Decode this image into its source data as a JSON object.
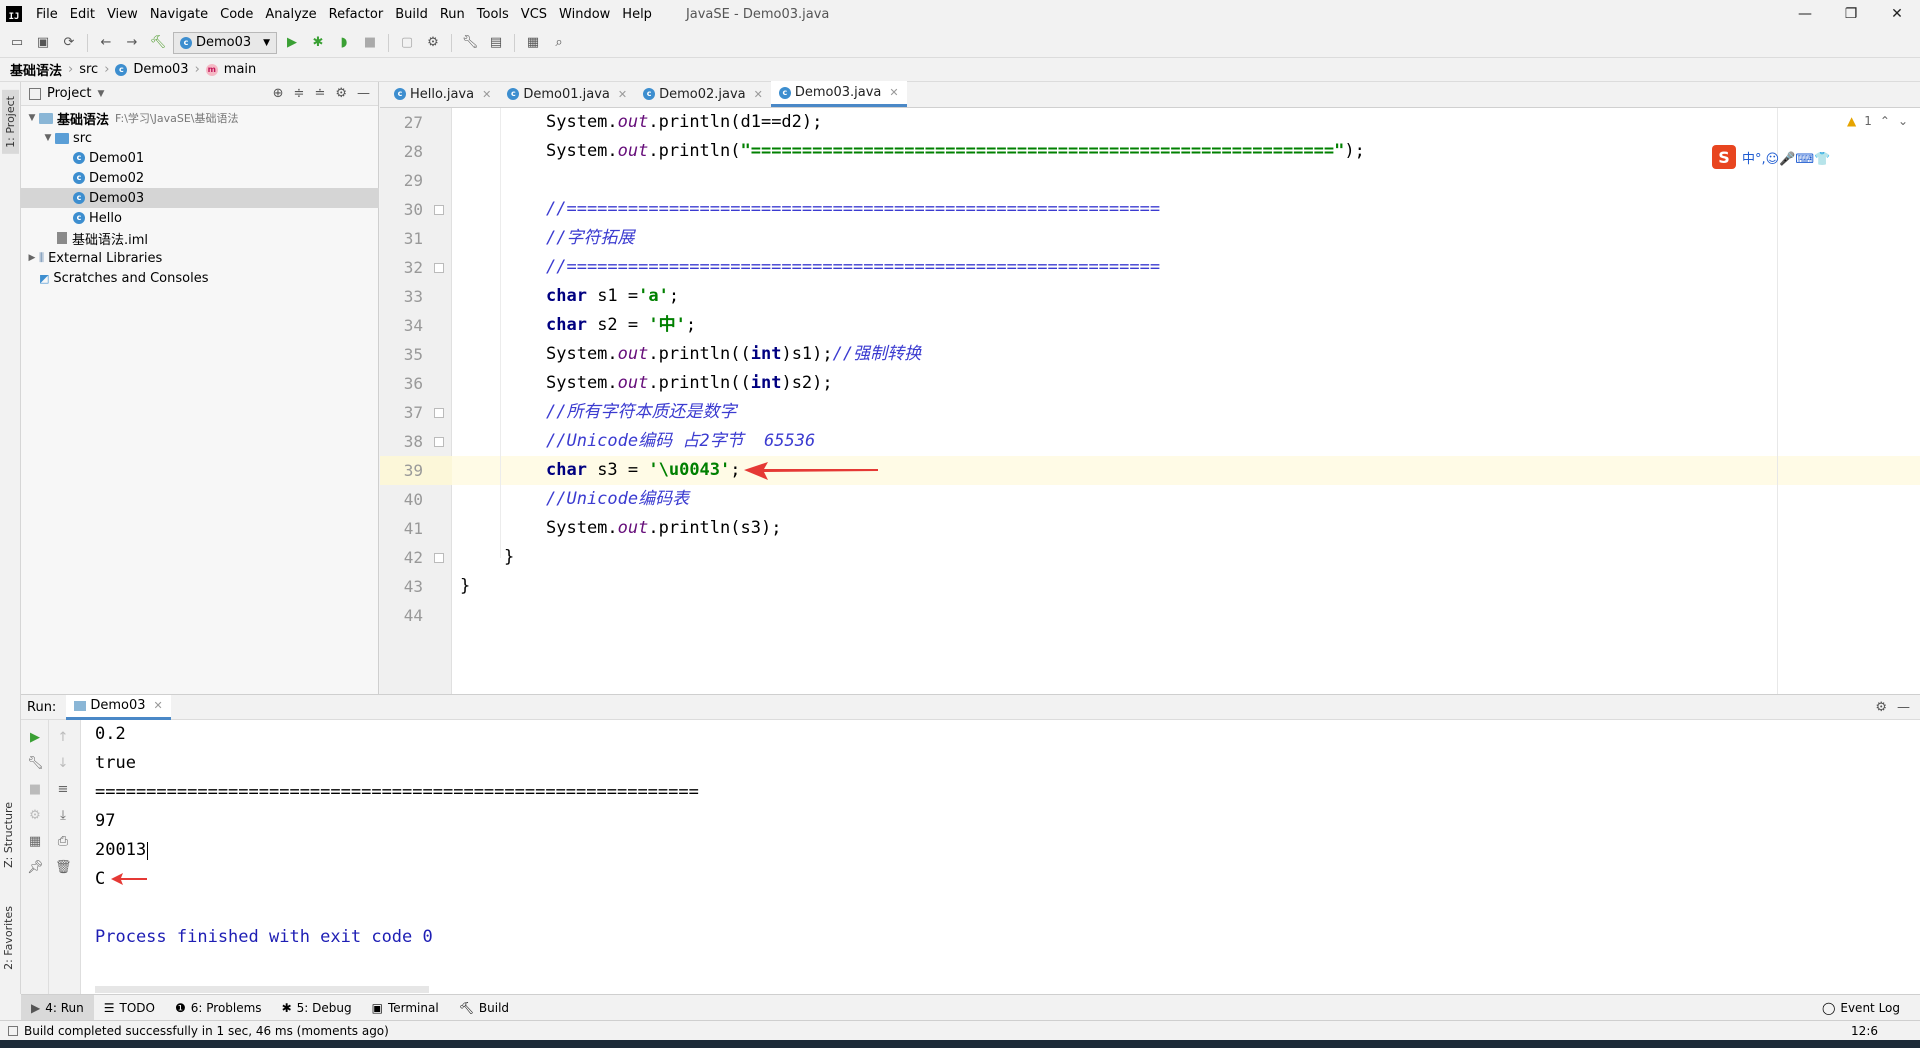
{
  "window": {
    "title": "JavaSE - Demo03.java",
    "logo": "IJ",
    "minimize": "—",
    "maximize": "❐",
    "close": "✕"
  },
  "menu": [
    "File",
    "Edit",
    "View",
    "Navigate",
    "Code",
    "Analyze",
    "Refactor",
    "Build",
    "Run",
    "Tools",
    "VCS",
    "Window",
    "Help"
  ],
  "toolbar": {
    "run_config": "Demo03"
  },
  "breadcrumb": {
    "project": "基础语法",
    "folder": "src",
    "class": "Demo03",
    "method": "main"
  },
  "left_strip": {
    "project_tab": "1: Project",
    "structure_tab": "Z: Structure",
    "favorites_tab": "2: Favorites"
  },
  "project_panel": {
    "title": "Project",
    "root": "基础语法",
    "root_path": "F:\\学习\\JavaSE\\基础语法",
    "src": "src",
    "classes": [
      "Demo01",
      "Demo02",
      "Demo03",
      "Hello"
    ],
    "iml": "基础语法.iml",
    "external": "External Libraries",
    "scratches": "Scratches and Consoles"
  },
  "editor": {
    "tabs": [
      "Hello.java",
      "Demo01.java",
      "Demo02.java",
      "Demo03.java"
    ],
    "active_tab": "Demo03.java",
    "inspection_count": "1",
    "line_numbers": [
      "27",
      "28",
      "29",
      "30",
      "31",
      "32",
      "33",
      "34",
      "35",
      "36",
      "37",
      "38",
      "39",
      "40",
      "41",
      "42",
      "43",
      "44"
    ],
    "separator": "==========================================================="
  },
  "code": {
    "l27": "System.out.println(d1==d2);",
    "l28_str": "\"=========================================================\"",
    "l30": "//==========================================================",
    "l31": "//字符拓展",
    "l32": "//==========================================================",
    "l33_var": " s1 =",
    "l33_str": "'a'",
    "l34_var": " s2 = ",
    "l34_str": "'中'",
    "l35_cmt": "//强制转换",
    "l37": "//所有字符本质还是数字",
    "l38": "//Unicode编码 占2字节  65536",
    "l39_var": " s3 = ",
    "l39_str": "'\\u0043'",
    "l40": "//Unicode编码表",
    "l42": "}",
    "l43": "}"
  },
  "ime": {
    "logo": "S",
    "text": "中°,☺🎤⌨👕"
  },
  "run": {
    "label": "Run:",
    "tab": "Demo03",
    "output": [
      "0.2",
      "true",
      "===========================================================",
      "97",
      "20013",
      "C",
      "",
      "Process finished with exit code 0"
    ]
  },
  "tool_tabs": {
    "run": "4: Run",
    "todo": "TODO",
    "problems": "6: Problems",
    "debug": "5: Debug",
    "terminal": "Terminal",
    "build": "Build",
    "event_log": "Event Log"
  },
  "status": {
    "message": "Build completed successfully in 1 sec, 46 ms (moments ago)",
    "position": "12:6"
  },
  "colors": {
    "keyword": "#000080",
    "string": "#008000",
    "comment": "#3b3bd0",
    "field": "#660e7a",
    "annotation_arrow": "#e53935"
  }
}
